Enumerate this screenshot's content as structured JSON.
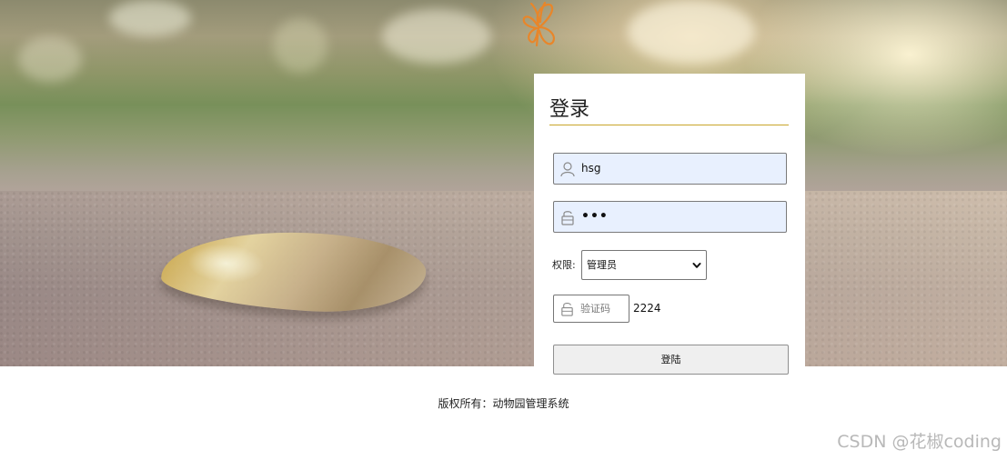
{
  "login": {
    "title": "登录",
    "username_value": "hsg",
    "password_value": "•••",
    "permission_label": "权限:",
    "permission_selected": "管理员",
    "captcha_placeholder": "验证码",
    "captcha_code": "2224",
    "submit_label": "登陆"
  },
  "footer": {
    "copyright": "版权所有：动物园管理系统"
  },
  "watermark": {
    "text": "CSDN @花椒coding"
  },
  "icons": {
    "logo": "butterfly-icon",
    "username": "user-icon",
    "password": "lock-icon",
    "captcha": "lock-icon",
    "select": "chevron-down-icon"
  },
  "colors": {
    "accent_underline": "#c9a52a",
    "field_fill": "#e8f0fe",
    "logo_orange": "#e8862a"
  }
}
